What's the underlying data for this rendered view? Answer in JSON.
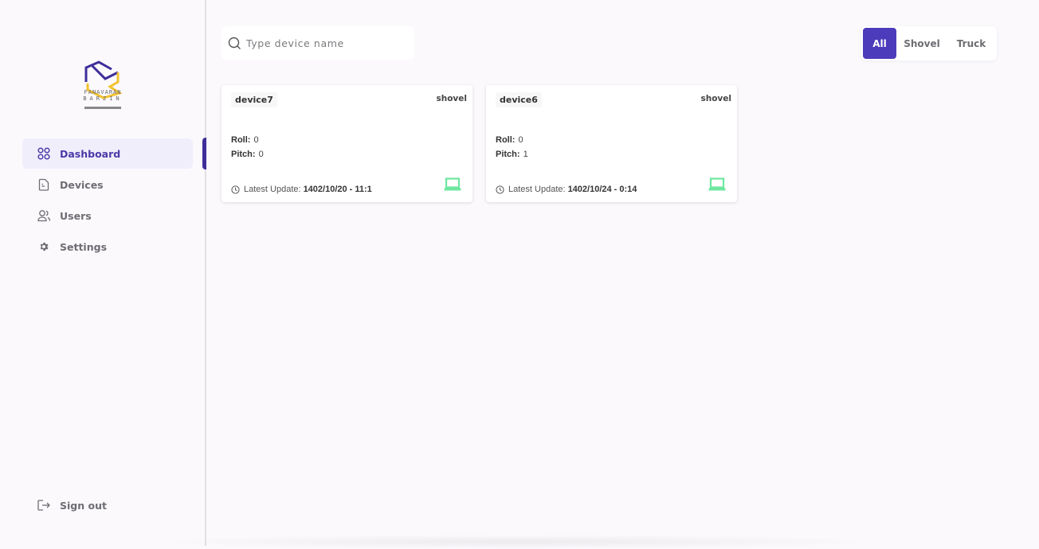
{
  "brand": {
    "line1": "FANAVARAN",
    "line2": "BARZIN",
    "colors": {
      "purple": "#3e2e9a",
      "yellow": "#f2c230"
    }
  },
  "sidebar": {
    "items": [
      {
        "label": "Dashboard",
        "icon": "grid-icon",
        "active": true
      },
      {
        "label": "Devices",
        "icon": "document-icon",
        "active": false
      },
      {
        "label": "Users",
        "icon": "users-icon",
        "active": false
      },
      {
        "label": "Settings",
        "icon": "gear-icon",
        "active": false
      }
    ],
    "signout_label": "Sign out"
  },
  "search": {
    "placeholder": "Type device name",
    "value": ""
  },
  "filters": {
    "options": [
      "All",
      "Shovel",
      "Truck"
    ],
    "selected": "All",
    "accent": "#4c3bbb"
  },
  "devices": [
    {
      "name": "device7",
      "type": "shovel",
      "roll_label": "Roll:",
      "roll": "0",
      "pitch_label": "Pitch:",
      "pitch": "0",
      "update_label": "Latest Update:",
      "updated": "1402/10/20 - 11:1",
      "status_color": "#6ee7a0"
    },
    {
      "name": "device6",
      "type": "shovel",
      "roll_label": "Roll:",
      "roll": "0",
      "pitch_label": "Pitch:",
      "pitch": "1",
      "update_label": "Latest Update:",
      "updated": "1402/10/24 - 0:14",
      "status_color": "#6ee7a0"
    }
  ]
}
